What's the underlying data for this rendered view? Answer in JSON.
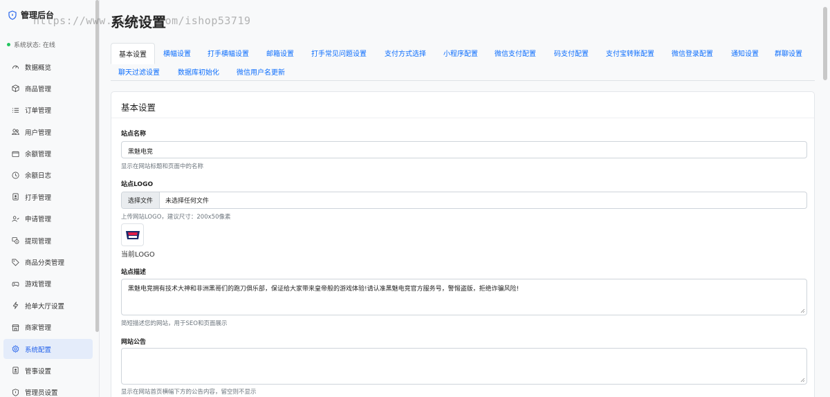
{
  "app": {
    "title": "管理后台",
    "status": "系统状态: 在线"
  },
  "watermark": "https://www.huzhan.com/ishop53719",
  "sidebar": {
    "items": [
      {
        "label": "数据概览",
        "icon": "gauge-icon"
      },
      {
        "label": "商品管理",
        "icon": "box-icon"
      },
      {
        "label": "订单管理",
        "icon": "list-icon"
      },
      {
        "label": "用户管理",
        "icon": "users-icon"
      },
      {
        "label": "余额管理",
        "icon": "wallet-icon"
      },
      {
        "label": "余额日志",
        "icon": "clock-icon"
      },
      {
        "label": "打手管理",
        "icon": "person-badge-icon"
      },
      {
        "label": "申请管理",
        "icon": "person-check-icon"
      },
      {
        "label": "提现管理",
        "icon": "cash-icon"
      },
      {
        "label": "商品分类管理",
        "icon": "tag-icon"
      },
      {
        "label": "游戏管理",
        "icon": "controller-icon"
      },
      {
        "label": "抢单大厅设置",
        "icon": "lightning-icon"
      },
      {
        "label": "商家管理",
        "icon": "shop-icon"
      },
      {
        "label": "系统配置",
        "icon": "gear-icon"
      },
      {
        "label": "管事设置",
        "icon": "person-badge-icon"
      },
      {
        "label": "管理员设置",
        "icon": "shield-icon"
      }
    ]
  },
  "main": {
    "title": "系统设置",
    "tabs": [
      "基本设置",
      "横幅设置",
      "打手横幅设置",
      "邮箱设置",
      "打手常见问题设置",
      "支付方式选择",
      "小程序配置",
      "微信支付配置",
      "码支付配置",
      "支付宝转账配置",
      "微信登录配置",
      "通知设置",
      "群聊设置",
      "聊天过滤设置",
      "数据库初始化",
      "微信用户名更新"
    ],
    "card": {
      "title": "基本设置",
      "site_name": {
        "label": "站点名称",
        "value": "黑魅电竞",
        "help": "显示在网站标题和页面中的名称"
      },
      "site_logo": {
        "label": "站点LOGO",
        "button": "选择文件",
        "status": "未选择任何文件",
        "help": "上传网站LOGO，建议尺寸：200x50像素",
        "current": "当前LOGO"
      },
      "site_desc": {
        "label": "站点描述",
        "value": "黑魅电竞拥有技术大神和非洲黑哥们的跑刀俱乐部，保证给大家带来皇帝般的游戏体验!请认准黑魅电竞官方服务号，警惕盗版，拒绝诈骗风险!",
        "help": "简短描述您的网站，用于SEO和页面展示"
      },
      "notice": {
        "label": "网站公告",
        "value": "",
        "help": "显示在网站首页横幅下方的公告内容，留空则不显示"
      }
    }
  },
  "colors": {
    "accent": "#0d6efd",
    "active_bg": "#e4ecfa",
    "status": "#22c55e"
  }
}
